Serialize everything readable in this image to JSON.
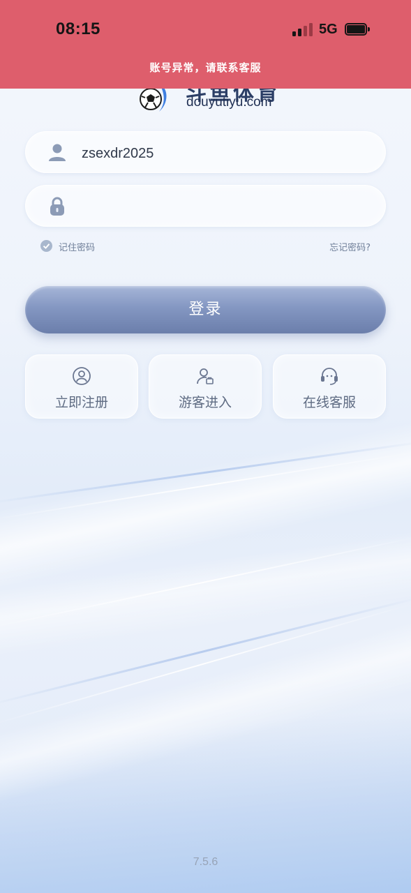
{
  "status_bar": {
    "time": "08:15",
    "network": "5G",
    "signal_level": 0.5,
    "battery_level": 1.0
  },
  "alert": {
    "text": "账号异常，请联系客服",
    "color": "#de5e6c"
  },
  "brand": {
    "logo_icon": "soccer-ball-icon",
    "name": "斗鱼体育",
    "domain": "douyutiyu.com"
  },
  "login_form": {
    "username": {
      "icon": "user-icon",
      "value": "zsexdr2025"
    },
    "password": {
      "icon": "lock-icon",
      "value": ""
    },
    "remember_label": "记住密码",
    "remember_checked": true,
    "forgot_label": "忘记密码?",
    "submit_label": "登录"
  },
  "quick_actions": [
    {
      "icon": "user-circle-icon",
      "label": "立即注册"
    },
    {
      "icon": "guest-user-icon",
      "label": "游客进入"
    },
    {
      "icon": "headset-icon",
      "label": "在线客服"
    }
  ],
  "version": "7.5.6",
  "colors": {
    "accent_button": "#8497c2",
    "alert_background": "#de5e6c"
  }
}
